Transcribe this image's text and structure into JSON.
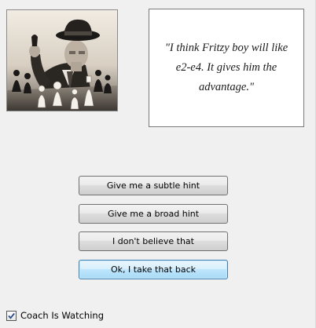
{
  "coach": {
    "quote": "\"I think Fritzy boy will like e2-e4. It gives him the advantage.\""
  },
  "buttons": {
    "subtle_hint": "Give me a subtle hint",
    "broad_hint": "Give me a broad hint",
    "dont_believe": "I don't believe that",
    "take_back": "Ok, I take that back"
  },
  "options": {
    "coach_watching_label": "Coach Is Watching",
    "coach_watching_checked": true
  },
  "colors": {
    "dialog_bg": "#f0f0f0",
    "default_button_border": "#3c7fb1",
    "check_mark": "#2b4b8a"
  }
}
